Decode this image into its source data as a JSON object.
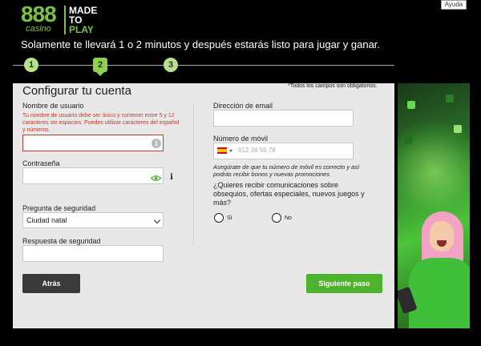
{
  "header": {
    "help_label": "Ayuda",
    "logo_number": "888",
    "logo_sub": "casino",
    "logo_tag_line1": "MADE",
    "logo_tag_line2": "TO",
    "logo_tag_line3": "PLAY",
    "tagline": "Solamente te llevará 1 o 2 minutos y después estarás listo para jugar y ganar."
  },
  "steps": [
    "1",
    "2",
    "3"
  ],
  "active_step": "2",
  "form": {
    "title": "Configurar tu cuenta",
    "required_note": "*Todos los campos son obligatorios.",
    "username_label": "Nombre de usuario",
    "username_error": "Tu nombre de usuario debe ser único y contener entre 5 y 12 caracteres sin espacios. Puedes utilizar caracteres del español y números.",
    "username_value": "",
    "password_label": "Contraseña",
    "password_value": "",
    "security_question_label": "Pregunta de seguridad",
    "security_question_selected": "Ciudad natal",
    "security_answer_label": "Respuesta de seguridad",
    "security_answer_value": "",
    "email_label": "Dirección de email",
    "email_value": "",
    "mobile_label": "Número de móvil",
    "mobile_placeholder": "612 34 56 78",
    "mobile_hint": "Asegúrate de que tu número de móvil es correcto y así podrás recibir bonos y nuevas promociones",
    "promo_question": "¿Quieres recibir comunicaciones sobre obsequios, ofertas especiales, nuevos juegos y más?",
    "option_yes": "Sí",
    "option_no": "No",
    "back_button": "Atrás",
    "next_button": "Siguiente paso"
  },
  "colors": {
    "brand_green": "#7bc242",
    "next_button": "#4db32f",
    "back_button": "#3a3a3a",
    "error_red": "#c0392b"
  },
  "icons": {
    "info": "info-icon",
    "eye": "eye-icon",
    "flag": "spain-flag-icon"
  }
}
